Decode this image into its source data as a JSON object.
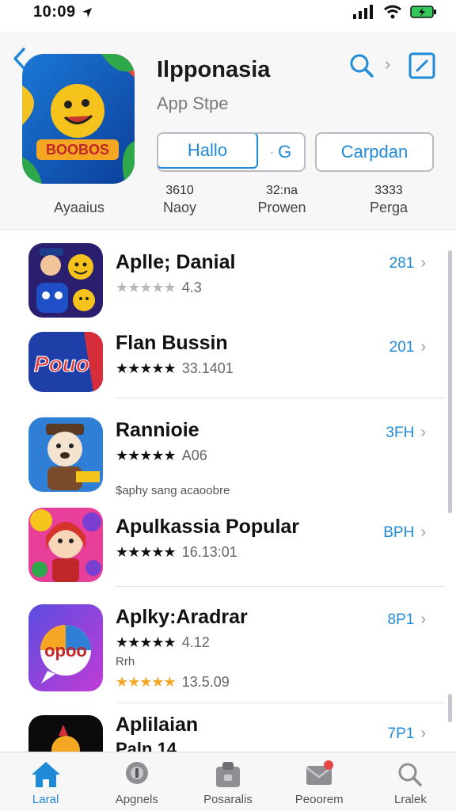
{
  "status": {
    "time": "10:09"
  },
  "header": {
    "title": "Ilpponasia",
    "subtitle": "App Stpe",
    "segment_left": "Hallo",
    "segment_right": "G",
    "campaign_button": "Carpdan",
    "icon_caption": "Ayaaius",
    "stats": [
      {
        "value": "3610",
        "label": "Naoy"
      },
      {
        "value": "32:na",
        "label": "Prowen"
      },
      {
        "value": "3333",
        "label": "Perga"
      }
    ]
  },
  "apps": [
    {
      "title": "Aplle; Danial",
      "stars": 5,
      "filled": 0,
      "rating": "4.3",
      "price": "281",
      "extra": "",
      "note": ""
    },
    {
      "title": "Flan Bussin",
      "stars": 5,
      "filled": 4,
      "rating": "33.1401",
      "price": "201",
      "extra": "",
      "note": ""
    },
    {
      "title": "Rannioie",
      "stars": 5,
      "filled": 4,
      "rating": "A06",
      "price": "3FH",
      "extra": "",
      "note": "$aphy sang acaoobre"
    },
    {
      "title": "Apulkassia Popular",
      "stars": 5,
      "filled": 4,
      "rating": "16.13:01",
      "price": "BPH",
      "extra": "",
      "note": ""
    },
    {
      "title": "Aplky:Aradrar",
      "stars": 5,
      "filled": 4,
      "rating": "4.12",
      "price": "8P1",
      "extra": "Rrh",
      "note": "",
      "rating2": "13.5.09"
    },
    {
      "title": "Aplilaian",
      "stars": 5,
      "filled": 4,
      "rating": "",
      "price": "7P1",
      "extra": "",
      "note": "",
      "subtitle2": "Paln 14"
    }
  ],
  "tabs": [
    {
      "label": "Laral",
      "icon": "home-icon",
      "active": true
    },
    {
      "label": "Apgnels",
      "icon": "games-icon",
      "active": false
    },
    {
      "label": "Posaralis",
      "icon": "apps-icon",
      "active": false
    },
    {
      "label": "Peoorem",
      "icon": "updates-icon",
      "active": false
    },
    {
      "label": "Lralek",
      "icon": "search-icon",
      "active": false
    }
  ],
  "colors": {
    "accent": "#1f8ad8",
    "star": "#f5a623"
  }
}
